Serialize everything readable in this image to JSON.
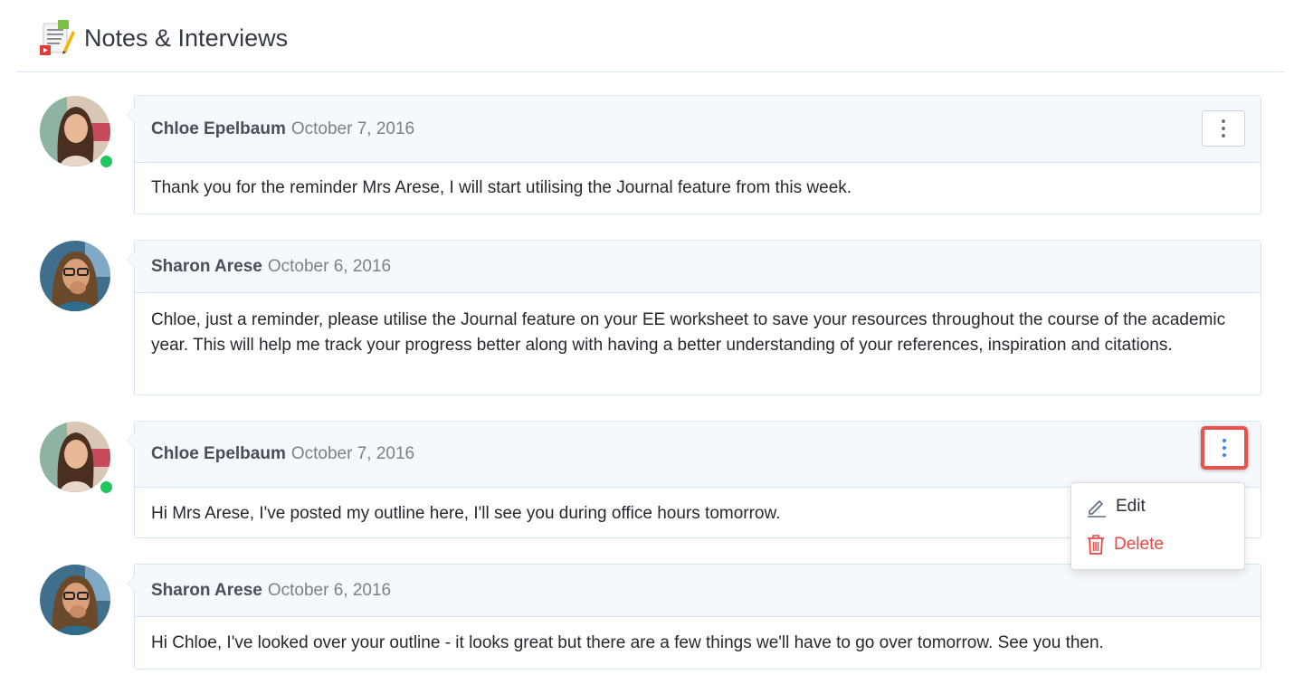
{
  "header": {
    "title": "Notes & Interviews",
    "icon": "notes-icon"
  },
  "notes": [
    {
      "author": "Chloe Epelbaum",
      "date": "October 7, 2016",
      "body": "Thank you for the reminder Mrs Arese, I will start utilising the Journal feature from this week.",
      "online": true,
      "menu_open": false
    },
    {
      "author": "Sharon Arese",
      "date": "October 6, 2016",
      "body": "Chloe, just a reminder, please utilise the Journal feature on your EE worksheet to save your resources throughout the course of the academic year. This will help me track your progress better along with having a better understanding of your references, inspiration and citations.",
      "online": false,
      "menu_open": false
    },
    {
      "author": "Chloe Epelbaum",
      "date": "October 7, 2016",
      "body": "Hi Mrs Arese, I've posted my outline here, I'll see you during office hours tomorrow.",
      "online": true,
      "menu_open": true
    },
    {
      "author": "Sharon Arese",
      "date": "October 6, 2016",
      "body": "Hi Chloe, I've looked over your outline - it looks great but there are a few things we'll have to go over tomorrow. See you then.",
      "online": false,
      "menu_open": false
    }
  ],
  "dropdown": {
    "edit_label": "Edit",
    "delete_label": "Delete",
    "delete_color": "#ef4444"
  },
  "colors": {
    "online": "#22c55e",
    "highlight": "#e8524a",
    "accent": "#3b82f6"
  }
}
